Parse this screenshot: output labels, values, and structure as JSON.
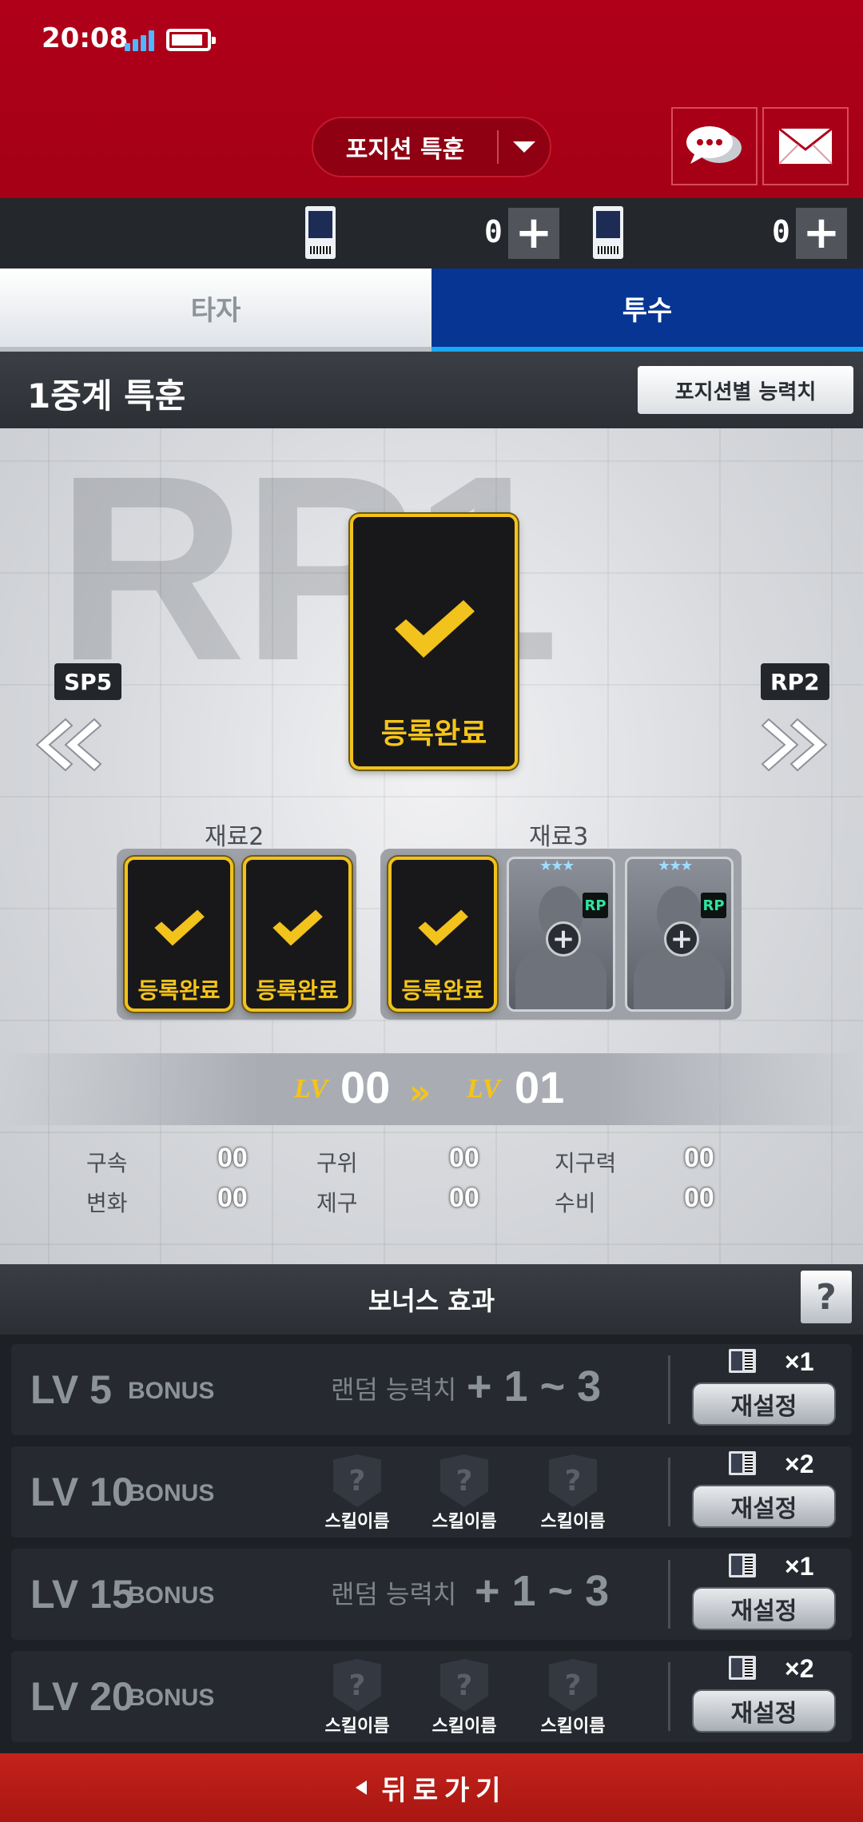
{
  "status_bar": {
    "time": "20:08"
  },
  "header": {
    "mode_label": "포지션 특훈",
    "chat_icon": "chat-bubbles-icon",
    "mail_icon": "envelope-icon"
  },
  "currencies": [
    {
      "icon": "ticket-icon",
      "count": "0"
    },
    {
      "icon": "ticket-icon",
      "count": "0"
    }
  ],
  "tabs": [
    {
      "label": "타자",
      "active": false
    },
    {
      "label": "투수",
      "active": true
    }
  ],
  "section": {
    "title": "1중계 특훈",
    "position_stats_label": "포지션별 능력치"
  },
  "training": {
    "watermark": "RP1",
    "prev_position": "SP5",
    "next_position": "RP2",
    "main_card_label": "등록완료",
    "material_groups": [
      {
        "label": "재료2",
        "slots": [
          "등록완료",
          "등록완료"
        ]
      },
      {
        "label": "재료3",
        "slots": [
          "등록완료",
          "",
          ""
        ]
      }
    ],
    "empty_slot_tag": "RP",
    "empty_slot_stars": "★★★",
    "level_prefix": "LV",
    "level_from": "00",
    "level_to": "01",
    "stats": [
      {
        "name": "구속",
        "value": "00"
      },
      {
        "name": "구위",
        "value": "00"
      },
      {
        "name": "지구력",
        "value": "00"
      },
      {
        "name": "변화",
        "value": "00"
      },
      {
        "name": "제구",
        "value": "00"
      },
      {
        "name": "수비",
        "value": "00"
      }
    ]
  },
  "bonus": {
    "title": "보너스 효과",
    "help_label": "?",
    "rows": [
      {
        "level": "LV 5",
        "word": "BONUS",
        "desc": "랜덤 능력치",
        "range": "+ 1 ~ 3",
        "cost": "×1",
        "reset": "재설정"
      },
      {
        "level": "LV 10",
        "word": "BONUS",
        "skills": [
          "스킬이름",
          "스킬이름",
          "스킬이름"
        ],
        "cost": "×2",
        "reset": "재설정"
      },
      {
        "level": "LV 15",
        "word": "BONUS",
        "desc": "랜덤 능력치",
        "range": "+ 1 ~ 3",
        "cost": "×1",
        "reset": "재설정"
      },
      {
        "level": "LV 20",
        "word": "BONUS",
        "skills": [
          "스킬이름",
          "스킬이름",
          "스킬이름"
        ],
        "cost": "×2",
        "reset": "재설정"
      }
    ],
    "skill_placeholder": "?"
  },
  "footer": {
    "back_label": "뒤로가기"
  },
  "colors": {
    "header_red": "#b00019",
    "tab_active": "#063594",
    "card_gold": "#f2c21d",
    "back_red": "#c3231b"
  }
}
